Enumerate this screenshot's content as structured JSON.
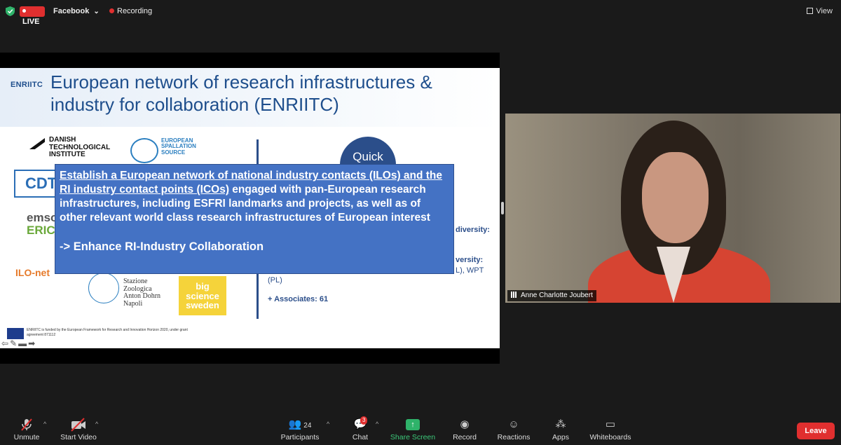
{
  "topbar": {
    "live_label": "LIVE",
    "stream_target": "Facebook",
    "recording_label": "Recording",
    "view_label": "View"
  },
  "slide": {
    "logo_text": "ENRIITC",
    "title": "European network of research infrastructures & industry for collaboration (ENRIITC)",
    "partner_logos": {
      "dti": "DANISH TECHNOLOGICAL INSTITUTE",
      "ess": "EUROPEAN SPALLATION SOURCE",
      "cdt": "CDT",
      "emso": "emso",
      "emso_eri": "ERIC",
      "ilo": "ILO-net",
      "szn": "Stazione Zoologica Anton Dohrn Napoli",
      "big": "big science sweden"
    },
    "quick_label": "Quick",
    "right_text": {
      "line1": "diversity:",
      "line2": "versity:",
      "line3": "L), WPT",
      "line4": "(PL)",
      "associates": "+ Associates: 61"
    },
    "funding_text": "ENRIITC is funded by the European Framework for Research and Innovation Horizon 2020, under grant agreement 871112",
    "callout": {
      "underlined": "Establish a European network of national industry contacts (ILOs) and the RI industry contact points (ICOs)",
      "rest": "  engaged with pan-European research infrastructures, including ESFRI landmarks and projects, as well as of other relevant world class research infrastructures of European interest",
      "subline": "-> Enhance RI-Industry Collaboration"
    }
  },
  "speaker": {
    "name": "Anne Charlotte Joubert"
  },
  "toolbar": {
    "unmute": "Unmute",
    "start_video": "Start Video",
    "participants": "Participants",
    "participants_count": "24",
    "chat": "Chat",
    "chat_badge": "3",
    "share_screen": "Share Screen",
    "record": "Record",
    "reactions": "Reactions",
    "apps": "Apps",
    "whiteboards": "Whiteboards",
    "leave": "Leave"
  },
  "colors": {
    "live_red": "#e02f2f",
    "share_green": "#3cc97a",
    "callout_blue": "#4472c4",
    "slide_title_blue": "#1e4e8c"
  }
}
